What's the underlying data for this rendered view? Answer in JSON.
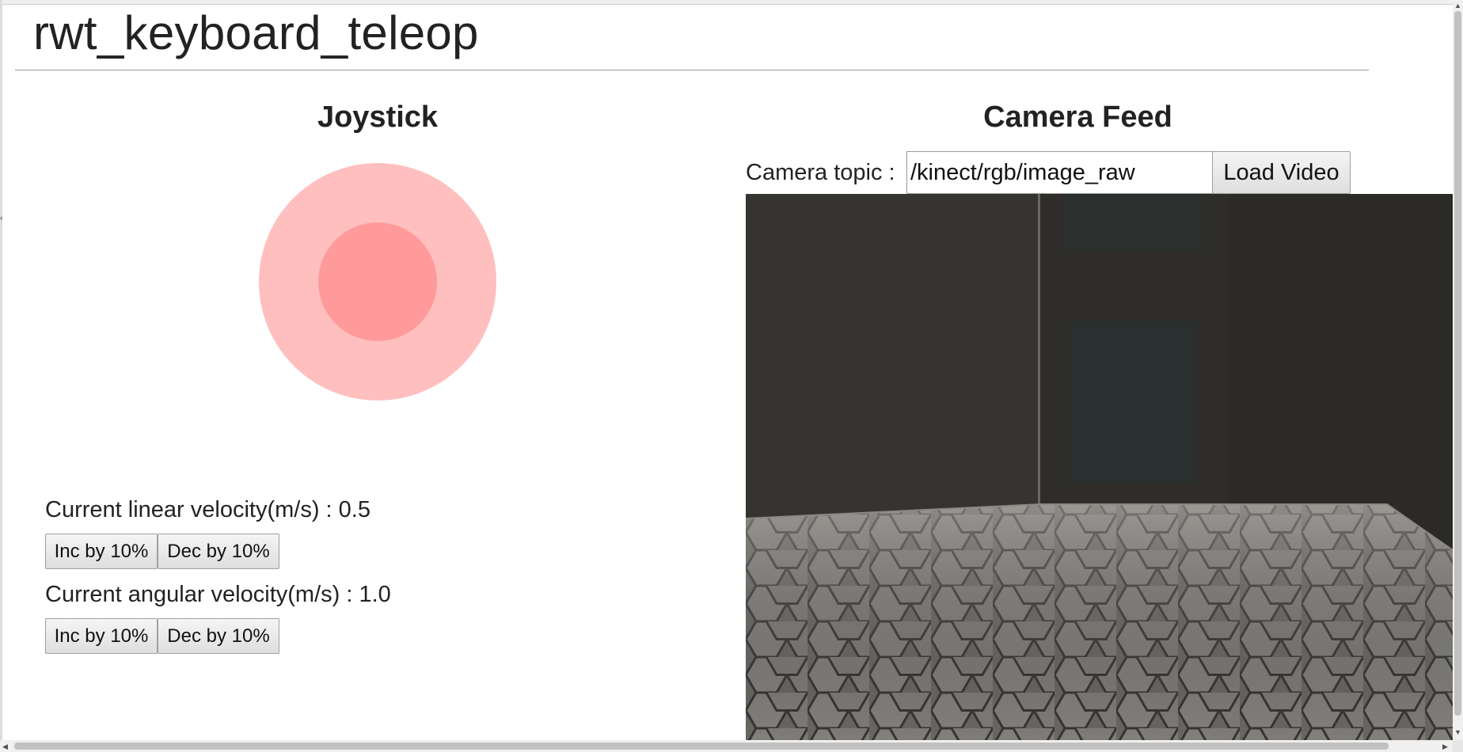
{
  "page": {
    "title": "rwt_keyboard_teleop"
  },
  "joystick": {
    "heading": "Joystick",
    "base_color": "#ffbfbf",
    "knob_color": "#ff9a9a"
  },
  "linear": {
    "label": "Current linear velocity(m/s) : 0.5",
    "value": 0.5,
    "inc_label": "Inc by 10%",
    "dec_label": "Dec by 10%"
  },
  "angular": {
    "label": "Current angular velocity(m/s) : 1.0",
    "value": 1.0,
    "inc_label": "Inc by 10%",
    "dec_label": "Dec by 10%"
  },
  "camera": {
    "heading": "Camera Feed",
    "topic_label": "Camera topic :",
    "topic_value": "/kinect/rgb/image_raw",
    "load_button": "Load Video"
  },
  "icons": {
    "scroll_up": "▲",
    "scroll_down": "▼",
    "scroll_left": "◀",
    "scroll_right": "▶",
    "left_marker": "‹"
  }
}
